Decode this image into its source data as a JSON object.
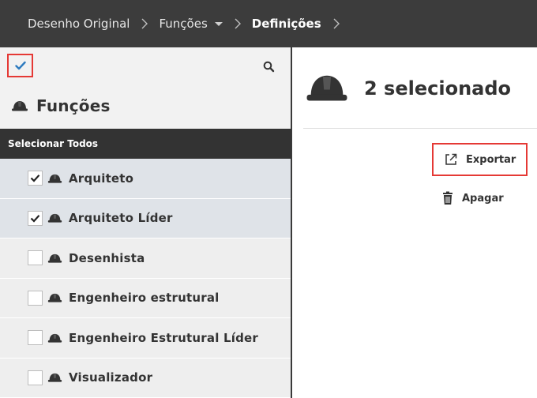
{
  "breadcrumb": {
    "items": [
      {
        "label": "Desenho Original"
      },
      {
        "label": "Funções"
      },
      {
        "label": "Definições"
      }
    ]
  },
  "left_panel": {
    "title": "Funções",
    "select_all_label": "Selecionar Todos",
    "items": [
      {
        "label": "Arquiteto",
        "checked": true
      },
      {
        "label": "Arquiteto Líder",
        "checked": true
      },
      {
        "label": "Desenhista",
        "checked": false
      },
      {
        "label": "Engenheiro estrutural",
        "checked": false
      },
      {
        "label": "Engenheiro Estrutural Líder",
        "checked": false
      },
      {
        "label": "Visualizador",
        "checked": false
      }
    ]
  },
  "right_panel": {
    "selection_text": "2 selecionado",
    "actions": {
      "export_label": "Exportar",
      "delete_label": "Apagar"
    }
  },
  "colors": {
    "topbar": "#3c3c3c",
    "highlight_border": "#e53935",
    "check_accent": "#2e7bbf",
    "selected_row": "#dfe3e8",
    "row": "#eeeeee"
  }
}
